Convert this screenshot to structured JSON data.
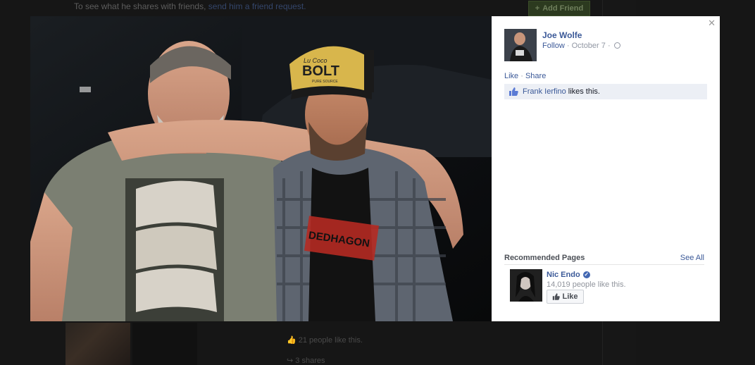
{
  "background": {
    "top_text": "To see what he shares with friends,",
    "top_link": "send him a friend request.",
    "add_friend_label": "Add Friend",
    "likes_text": "21 people like this.",
    "shares_text": "3 shares"
  },
  "post": {
    "author": "Joe Wolfe",
    "follow_label": "Follow",
    "separator": " · ",
    "date": "October 7",
    "like_label": "Like",
    "share_label": "Share",
    "liker": "Frank Ierfino",
    "liker_suffix": "likes this."
  },
  "photo": {
    "cap_text_main": "BOLT",
    "cap_text_top": "Lu Coco",
    "cap_text_bottom": "PURE SOURCE",
    "shirt_text": "DEDHAGON"
  },
  "recommended": {
    "title": "Recommended Pages",
    "see_all": "See All",
    "page_name": "Nic Endo",
    "page_likes": "14,019 people like this.",
    "like_button": "Like"
  },
  "colors": {
    "link": "#3b5998",
    "muted": "#9197a3",
    "like_box_bg": "#eceff5"
  },
  "icons": {
    "close": "close-icon",
    "globe": "globe-icon",
    "thumbs_up": "thumbs-up-icon",
    "verified": "verified-badge-icon"
  }
}
